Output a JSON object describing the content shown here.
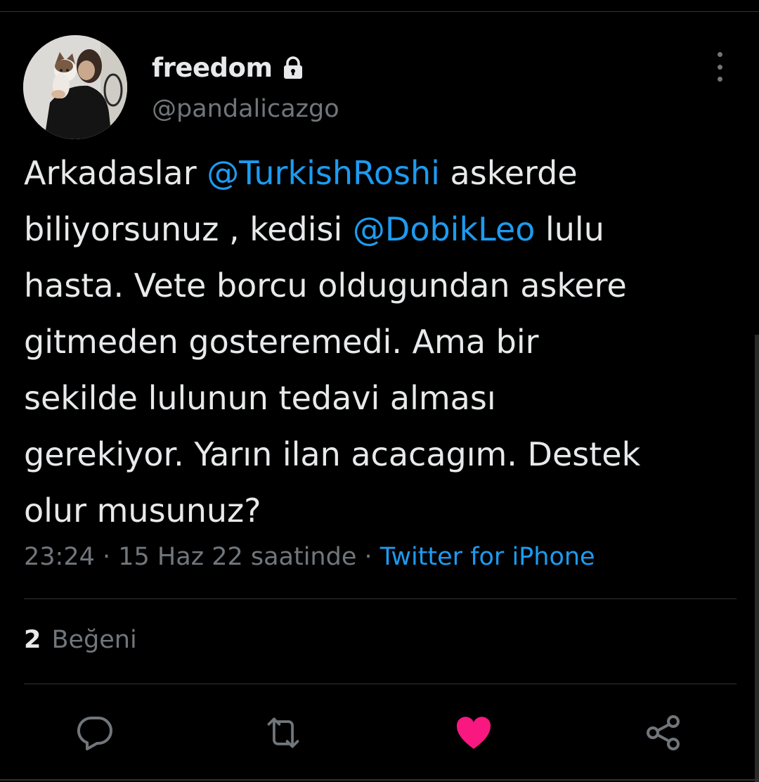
{
  "tweet": {
    "author": {
      "display_name": "freedom",
      "handle": "@pandalicazgo",
      "protected": true
    },
    "text_lines": [
      [
        {
          "t": "Arkadaslar "
        },
        {
          "t": "@TurkishRoshi",
          "mention": true
        },
        {
          "t": " askerde"
        }
      ],
      [
        {
          "t": "biliyorsunuz , kedisi "
        },
        {
          "t": "@DobikLeo",
          "mention": true
        },
        {
          "t": " lulu"
        }
      ],
      [
        {
          "t": "hasta. Vete borcu oldugundan askere"
        }
      ],
      [
        {
          "t": "gitmeden gosteremedi. Ama bir"
        }
      ],
      [
        {
          "t": "sekilde lulunun tedavi alması"
        }
      ],
      [
        {
          "t": "gerekiyor. Yarın ilan acacagım. Destek"
        }
      ],
      [
        {
          "t": "olur musunuz?"
        }
      ]
    ],
    "time": "23:24",
    "date": "15 Haz 22 saatinde",
    "separator": " · ",
    "source": "Twitter for iPhone",
    "likes_count": "2",
    "likes_label": "Beğeni"
  },
  "actions": {
    "reply_icon": "reply-icon",
    "retweet_icon": "retweet-icon",
    "like_icon": "like-icon",
    "share_icon": "share-icon",
    "liked": true
  },
  "colors": {
    "background": "#000000",
    "text": "#e7e9ea",
    "secondary": "#71767b",
    "accent": "#1d9bf0",
    "like": "#f91880",
    "divider": "#2f3336"
  }
}
